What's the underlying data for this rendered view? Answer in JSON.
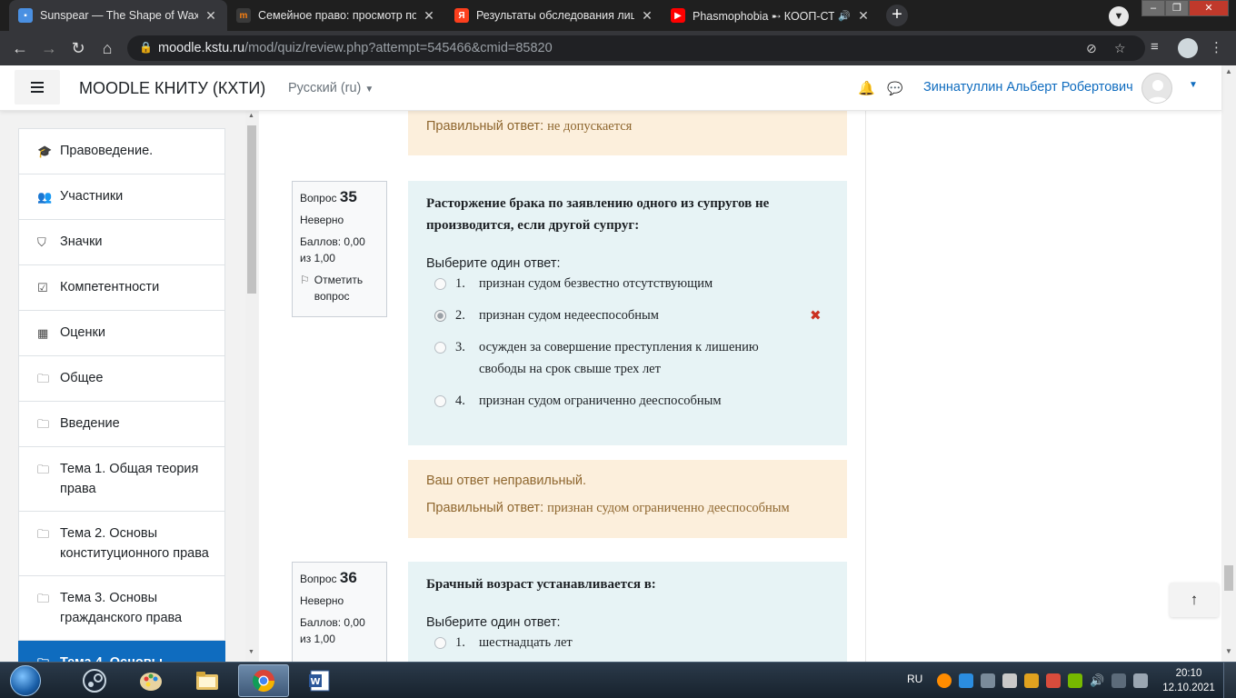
{
  "browser": {
    "tabs": [
      {
        "title": "Sunspear — The Shape of Wax",
        "favicon": "chat-icon",
        "color": "#4a90e2",
        "active": true
      },
      {
        "title": "Семейное право: просмотр поп",
        "favicon": "moodle-icon",
        "color": "#f98012",
        "active": false
      },
      {
        "title": "Результаты обследования лица,",
        "favicon": "yandex-icon",
        "color": "#fc3f1d",
        "active": false
      },
      {
        "title": "Phasmophobia ➸ КООП-СТР",
        "favicon": "youtube-icon",
        "color": "#ff0000",
        "active": false
      }
    ],
    "url_host": "moodle.kstu.ru",
    "url_path": "/mod/quiz/review.php?attempt=545466&cmid=85820"
  },
  "navbar": {
    "site_name": "MOODLE КНИТУ (КХТИ)",
    "language": "Русский (ru)",
    "user_name": "Зиннатуллин Альберт Робертович"
  },
  "drawer": {
    "items": [
      {
        "label": "Правоведение.",
        "icon": "graduation-cap-icon",
        "glyph": "🎓"
      },
      {
        "label": "Участники",
        "icon": "users-icon",
        "glyph": "👥"
      },
      {
        "label": "Значки",
        "icon": "shield-icon",
        "glyph": "⛉"
      },
      {
        "label": "Компетентности",
        "icon": "checkbox-icon",
        "glyph": "☑"
      },
      {
        "label": "Оценки",
        "icon": "table-icon",
        "glyph": "▦"
      },
      {
        "label": "Общее",
        "icon": "folder-icon",
        "glyph": "🗀"
      },
      {
        "label": "Введение",
        "icon": "folder-icon",
        "glyph": "🗀"
      },
      {
        "label": "Тема 1. Общая теория права",
        "icon": "folder-icon",
        "glyph": "🗀"
      },
      {
        "label": "Тема 2. Основы конституционного права",
        "icon": "folder-icon",
        "glyph": "🗀"
      },
      {
        "label": "Тема 3. Основы гражданского права",
        "icon": "folder-icon",
        "glyph": "🗀"
      },
      {
        "label": "Тема 4. Основы",
        "icon": "folder-icon",
        "glyph": "🗀",
        "active": true
      }
    ]
  },
  "prev_feedback": {
    "label": "Правильный ответ:",
    "answer": "не допускается"
  },
  "questions": [
    {
      "qno_label": "Вопрос",
      "number": "35",
      "state": "Неверно",
      "grade": "Баллов: 0,00 из 1,00",
      "flag": "Отметить вопрос",
      "text": "Расторжение брака по заявлению одного из супругов не производится, если другой супруг:",
      "prompt": "Выберите один ответ:",
      "options": [
        {
          "num": "1.",
          "text": "признан судом безвестно отсутствующим",
          "checked": false,
          "wrong": false
        },
        {
          "num": "2.",
          "text": "признан судом недееспособным",
          "checked": true,
          "wrong": true
        },
        {
          "num": "3.",
          "text": "осужден за совершение преступления к лишению свободы на срок свыше трех лет",
          "checked": false,
          "wrong": false
        },
        {
          "num": "4.",
          "text": "признан судом ограниченно дееспособным",
          "checked": false,
          "wrong": false
        }
      ],
      "feedback_incorrect": "Ваш ответ неправильный.",
      "feedback_label": "Правильный ответ:",
      "feedback_answer": "признан судом ограниченно дееспособным"
    },
    {
      "qno_label": "Вопрос",
      "number": "36",
      "state": "Неверно",
      "grade": "Баллов: 0,00 из 1,00",
      "text": "Брачный возраст устанавливается в:",
      "prompt": "Выберите один ответ:",
      "options": [
        {
          "num": "1.",
          "text": "шестнадцать лет",
          "checked": false,
          "wrong": false
        }
      ]
    }
  ],
  "taskbar": {
    "language": "RU",
    "time": "20:10",
    "date": "12.10.2021",
    "apps": [
      {
        "name": "steam-icon",
        "color": "#1b2838"
      },
      {
        "name": "paint-icon",
        "color": "#e8a33c"
      },
      {
        "name": "explorer-icon",
        "color": "#e9c46a"
      },
      {
        "name": "chrome-icon",
        "color": "#4caf50",
        "active": true
      },
      {
        "name": "word-icon",
        "color": "#2b579a"
      }
    ]
  },
  "colors": {
    "accent": "#0f6cbf",
    "feedback_bg": "#fcefdc",
    "question_bg": "#e7f3f5",
    "incorrect": "#ca3120"
  }
}
